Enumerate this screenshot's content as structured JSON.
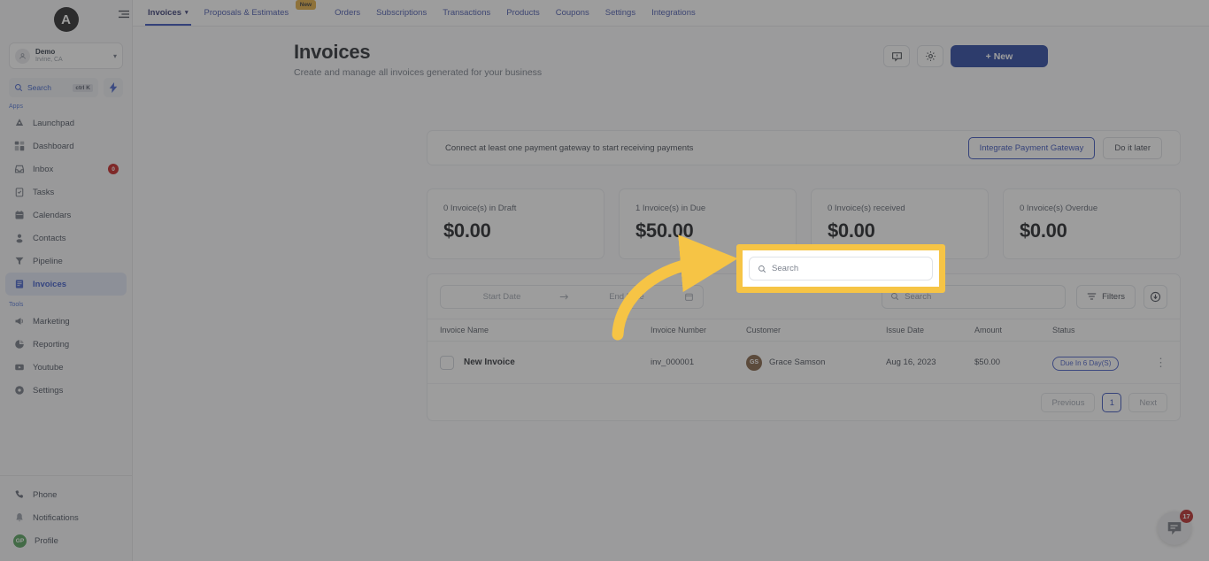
{
  "sidebar": {
    "logo_letter": "A",
    "account": {
      "name": "Demo",
      "location": "Irvine, CA"
    },
    "search": {
      "label": "Search",
      "shortcut": "ctrl K"
    },
    "apps_label": "Apps",
    "tools_label": "Tools",
    "apps": [
      {
        "label": "Launchpad",
        "icon": "rocket-icon",
        "badge": ""
      },
      {
        "label": "Dashboard",
        "icon": "grid-icon",
        "badge": ""
      },
      {
        "label": "Inbox",
        "icon": "inbox-icon",
        "badge": "0"
      },
      {
        "label": "Tasks",
        "icon": "clipboard-icon",
        "badge": ""
      },
      {
        "label": "Calendars",
        "icon": "calendar-icon",
        "badge": ""
      },
      {
        "label": "Contacts",
        "icon": "person-icon",
        "badge": ""
      },
      {
        "label": "Pipeline",
        "icon": "funnel-icon",
        "badge": ""
      },
      {
        "label": "Invoices",
        "icon": "receipt-icon",
        "badge": ""
      }
    ],
    "tools": [
      {
        "label": "Marketing",
        "icon": "megaphone-icon"
      },
      {
        "label": "Reporting",
        "icon": "pie-chart-icon"
      },
      {
        "label": "Youtube",
        "icon": "video-icon"
      },
      {
        "label": "Settings",
        "icon": "gear-icon"
      }
    ],
    "bottom": [
      {
        "label": "Phone",
        "icon": "phone-icon"
      },
      {
        "label": "Notifications",
        "icon": "bell-icon"
      }
    ],
    "profile": {
      "label": "Profile",
      "initials": "GP"
    }
  },
  "topnav": {
    "tabs": [
      {
        "label": "Invoices",
        "active": true,
        "caret": true,
        "badge": ""
      },
      {
        "label": "Proposals & Estimates",
        "active": false,
        "caret": false,
        "badge": "New"
      },
      {
        "label": "Orders",
        "active": false,
        "caret": false,
        "badge": ""
      },
      {
        "label": "Subscriptions",
        "active": false,
        "caret": false,
        "badge": ""
      },
      {
        "label": "Transactions",
        "active": false,
        "caret": false,
        "badge": ""
      },
      {
        "label": "Products",
        "active": false,
        "caret": false,
        "badge": ""
      },
      {
        "label": "Coupons",
        "active": false,
        "caret": false,
        "badge": ""
      },
      {
        "label": "Settings",
        "active": false,
        "caret": false,
        "badge": ""
      },
      {
        "label": "Integrations",
        "active": false,
        "caret": false,
        "badge": ""
      }
    ]
  },
  "header": {
    "title": "Invoices",
    "subtitle": "Create and manage all invoices generated for your business",
    "new_button": "+   New"
  },
  "gateway_banner": {
    "message": "Connect at least one payment gateway to start receiving payments",
    "primary_label": "Integrate Payment Gateway",
    "secondary_label": "Do it later"
  },
  "stats": [
    {
      "label": "0 Invoice(s) in Draft",
      "value": "$0.00"
    },
    {
      "label": "1 Invoice(s) in Due",
      "value": "$50.00"
    },
    {
      "label": "0 Invoice(s) received",
      "value": "$0.00"
    },
    {
      "label": "0 Invoice(s) Overdue",
      "value": "$0.00"
    }
  ],
  "toolbar": {
    "start_date_placeholder": "Start Date",
    "end_date_placeholder": "End Date",
    "search_placeholder": "Search",
    "filters_label": "Filters"
  },
  "table": {
    "columns": [
      "Invoice Name",
      "Invoice Number",
      "Customer",
      "Issue Date",
      "Amount",
      "Status"
    ],
    "rows": [
      {
        "name": "New Invoice",
        "number": "inv_000001",
        "customer": "Grace Samson",
        "customer_initials": "GS",
        "issue_date": "Aug 16, 2023",
        "amount": "$50.00",
        "status": "Due In 6 Day(S)"
      }
    ]
  },
  "pagination": {
    "previous": "Previous",
    "page": "1",
    "next": "Next"
  },
  "chat_widget": {
    "count": "17"
  },
  "colors": {
    "accent_blue": "#2f49b8",
    "primary_button": "#1f3d9c",
    "highlight_yellow": "#F6C445",
    "badge_red": "#b41f1f",
    "avatar_green": "#4b9b52",
    "avatar_brown": "#7d5a3c",
    "new_badge_gold": "#e0a93a"
  }
}
